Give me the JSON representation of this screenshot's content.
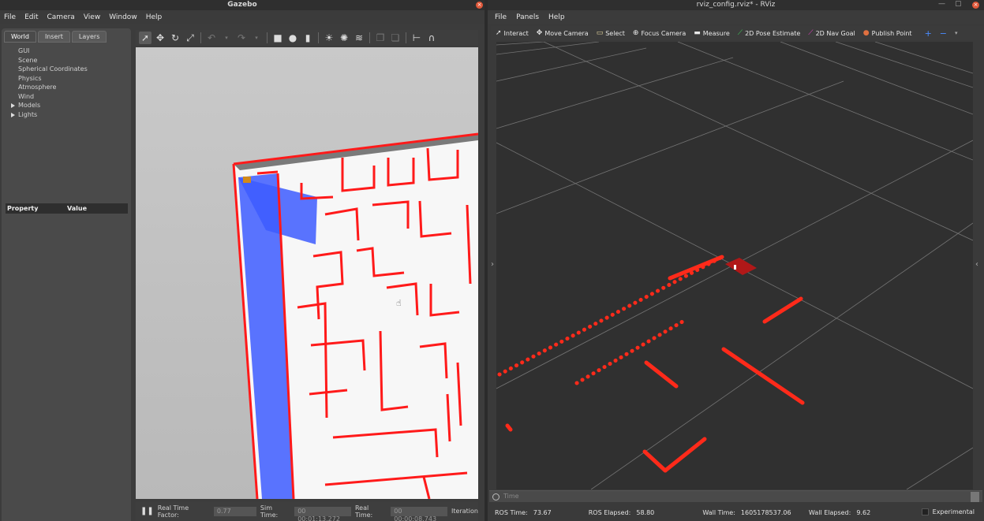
{
  "gazebo": {
    "title": "Gazebo",
    "menu": [
      "File",
      "Edit",
      "Camera",
      "View",
      "Window",
      "Help"
    ],
    "tabs": [
      "World",
      "Insert",
      "Layers"
    ],
    "tree": [
      "GUI",
      "Scene",
      "Spherical Coordinates",
      "Physics",
      "Atmosphere",
      "Wind",
      "Models",
      "Lights"
    ],
    "property_header": [
      "Property",
      "Value"
    ],
    "status": {
      "real_time_factor_label": "Real Time Factor:",
      "real_time_factor": "0.77",
      "sim_time_label": "Sim Time:",
      "sim_time": "00 00:01:13.272",
      "real_time_label": "Real Time:",
      "real_time": "00 00:00:08.743",
      "iterations_label": "Iteration"
    }
  },
  "rviz": {
    "title": "rviz_config.rviz* - RViz",
    "menu": [
      "File",
      "Panels",
      "Help"
    ],
    "tools": [
      {
        "label": "Interact",
        "icon": "cursor-icon"
      },
      {
        "label": "Move Camera",
        "icon": "move-icon"
      },
      {
        "label": "Select",
        "icon": "select-icon"
      },
      {
        "label": "Focus Camera",
        "icon": "focus-icon"
      },
      {
        "label": "Measure",
        "icon": "ruler-icon"
      },
      {
        "label": "2D Pose Estimate",
        "icon": "arrow-green-icon"
      },
      {
        "label": "2D Nav Goal",
        "icon": "arrow-pink-icon"
      },
      {
        "label": "Publish Point",
        "icon": "pin-icon"
      }
    ],
    "time_panel_label": "Time",
    "status": {
      "ros_time_label": "ROS Time:",
      "ros_time": "73.67",
      "ros_elapsed_label": "ROS Elapsed:",
      "ros_elapsed": "58.80",
      "wall_time_label": "Wall Time:",
      "wall_time": "1605178537.06",
      "wall_elapsed_label": "Wall Elapsed:",
      "wall_elapsed": "9.62",
      "experimental_label": "Experimental"
    }
  },
  "colors": {
    "wall_red": "#ff1a1a",
    "scan_red": "#ff2a1a",
    "costmap_blue": "#3d5cff"
  }
}
